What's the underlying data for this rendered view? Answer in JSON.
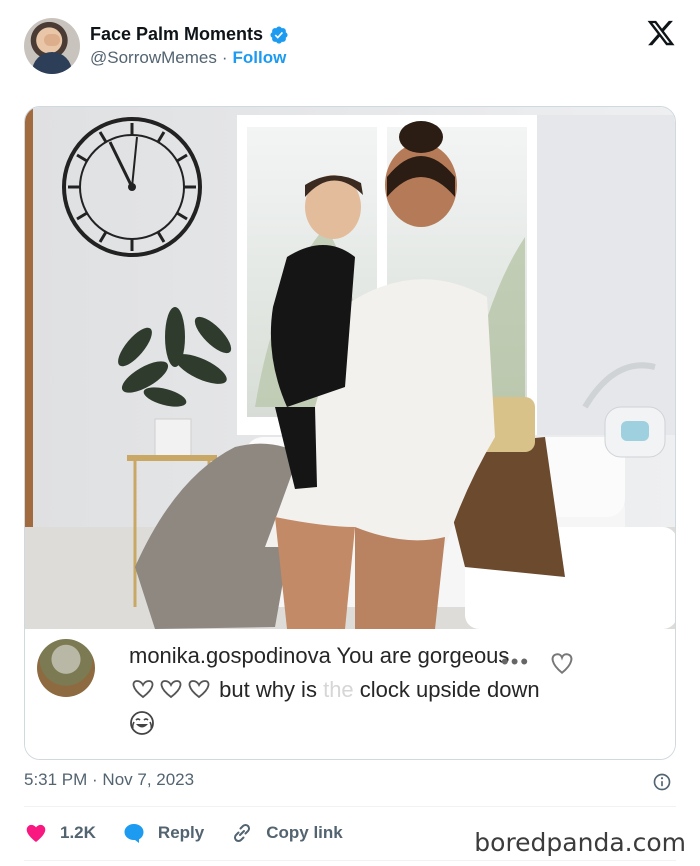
{
  "post": {
    "display_name": "Face Palm Moments",
    "handle": "@SorrowMemes",
    "separator": "·",
    "follow_label": "Follow",
    "timestamp": "5:31 PM · Nov 7, 2023",
    "icons": {
      "verified": "verified-badge-icon",
      "logo": "x-logo-icon",
      "info": "info-icon"
    }
  },
  "comment": {
    "username": "monika.gospodinova",
    "text_before": "You are gorgeous",
    "text_after": "but why is",
    "text_faded": "the",
    "text_end": "clock upside down",
    "more": "•••",
    "emoji_name": "crying-laughing-emoji"
  },
  "actions": {
    "likes_count": "1.2K",
    "reply_label": "Reply",
    "copy_label": "Copy link"
  },
  "watermark": "boredpanda.com",
  "colors": {
    "accent": "#1d9bf0",
    "like": "#f91880",
    "secondary_text": "#536471"
  }
}
